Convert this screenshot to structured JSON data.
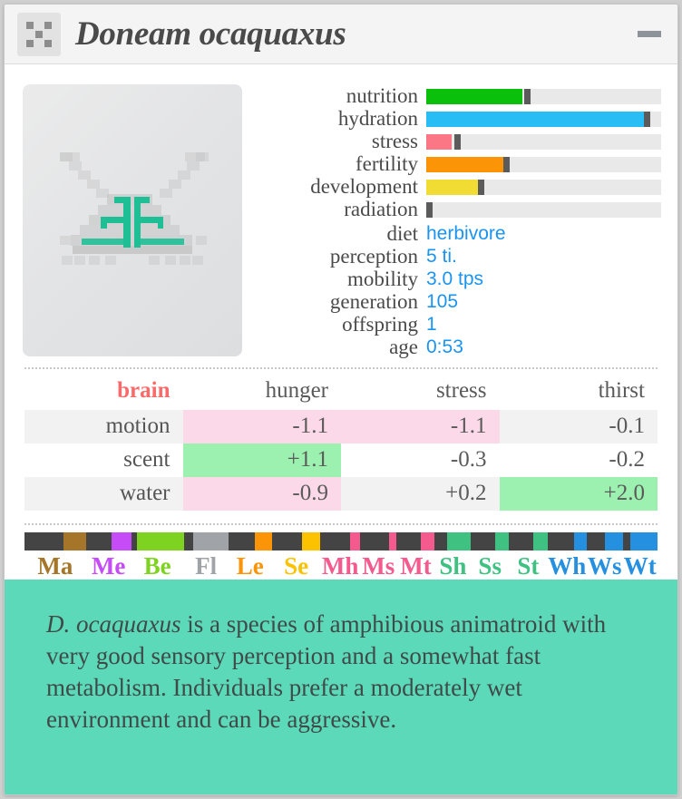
{
  "window": {
    "title": "Doneam ocaquaxus",
    "icon": "creature-pixel-icon",
    "minimize_label": "—"
  },
  "sprite": {
    "name": "creature-sprite",
    "body_color": "#c4c4c4",
    "accent_color": "#1fbf96"
  },
  "stats": {
    "bars": [
      {
        "label": "nutrition",
        "value": 41,
        "color": "#0ac00a",
        "mark": 43
      },
      {
        "label": "hydration",
        "value": 93,
        "color": "#29bdf5",
        "mark": 94
      },
      {
        "label": "stress",
        "value": 11,
        "color": "#fc7786",
        "mark": 13
      },
      {
        "label": "fertility",
        "value": 33,
        "color": "#fb9407",
        "mark": 34
      },
      {
        "label": "development",
        "value": 22,
        "color": "#f0dc33",
        "mark": 23
      },
      {
        "label": "radiation",
        "value": 0,
        "color": "#9e9e9e",
        "mark": 0
      }
    ],
    "values": [
      {
        "label": "diet",
        "value": "herbivore"
      },
      {
        "label": "perception",
        "value": "5 ti."
      },
      {
        "label": "mobility",
        "value": "3.0 tps"
      },
      {
        "label": "generation",
        "value": "105"
      },
      {
        "label": "offspring",
        "value": "1"
      },
      {
        "label": "age",
        "value": "0:53"
      }
    ],
    "value_color": "#1a94f0"
  },
  "brain": {
    "corner_label": "brain",
    "corner_color": "#fa6a6a",
    "columns": [
      "hunger",
      "stress",
      "thirst"
    ],
    "rows": [
      {
        "name": "motion",
        "cells": [
          {
            "text": "-1.1",
            "hl": "neg"
          },
          {
            "text": "-1.1",
            "hl": "neg"
          },
          {
            "text": "-0.1",
            "hl": "none"
          }
        ]
      },
      {
        "name": "scent",
        "cells": [
          {
            "text": "+1.1",
            "hl": "pos"
          },
          {
            "text": "-0.3",
            "hl": "none"
          },
          {
            "text": "-0.2",
            "hl": "none"
          }
        ]
      },
      {
        "name": "water",
        "cells": [
          {
            "text": "-0.9",
            "hl": "neg"
          },
          {
            "text": "+0.2",
            "hl": "none"
          },
          {
            "text": "+2.0",
            "hl": "pos"
          }
        ]
      }
    ]
  },
  "genes": {
    "separator_color": "#444444",
    "items": [
      {
        "label": "Ma",
        "color": "#a5762a",
        "width": 7.6,
        "gap": 12.8
      },
      {
        "label": "Me",
        "color": "#c54cf7",
        "width": 6.4,
        "gap": 8.6
      },
      {
        "label": "Be",
        "color": "#7ed321",
        "width": 15.5,
        "gap": 2.0
      },
      {
        "label": "Fl",
        "color": "#a0a4a8",
        "width": 11.7,
        "gap": 3.0
      },
      {
        "label": "Le",
        "color": "#fb9407",
        "width": 5.6,
        "gap": 9.0
      },
      {
        "label": "Se",
        "color": "#fcc200",
        "width": 6.0,
        "gap": 10.0
      },
      {
        "label": "Mh",
        "color": "#f45a8d",
        "width": 3.2,
        "gap": 10.0
      },
      {
        "label": "Ms",
        "color": "#f45a8d",
        "width": 2.6,
        "gap": 9.6
      },
      {
        "label": "Mt",
        "color": "#f45a8d",
        "width": 4.6,
        "gap": 8.0
      },
      {
        "label": "Sh",
        "color": "#3fc182",
        "width": 8.0,
        "gap": 4.0
      },
      {
        "label": "Ss",
        "color": "#3fc182",
        "width": 4.6,
        "gap": 8.0
      },
      {
        "label": "St",
        "color": "#3fc182",
        "width": 4.6,
        "gap": 8.2
      },
      {
        "label": "Wh",
        "color": "#2590e0",
        "width": 4.0,
        "gap": 9.0
      },
      {
        "label": "Ws",
        "color": "#2590e0",
        "width": 6.0,
        "gap": 6.0
      },
      {
        "label": "Wt",
        "color": "#2590e0",
        "width": 9.0,
        "gap": 2.5
      }
    ]
  },
  "footer": {
    "background": "#5bd9b9",
    "species_short": "D. ocaquaxus",
    "description": " is a species of amphibious animatroid with very good sensory perception and a somewhat fast metabolism. Individuals prefer a moderately wet environment and can be aggressive."
  }
}
